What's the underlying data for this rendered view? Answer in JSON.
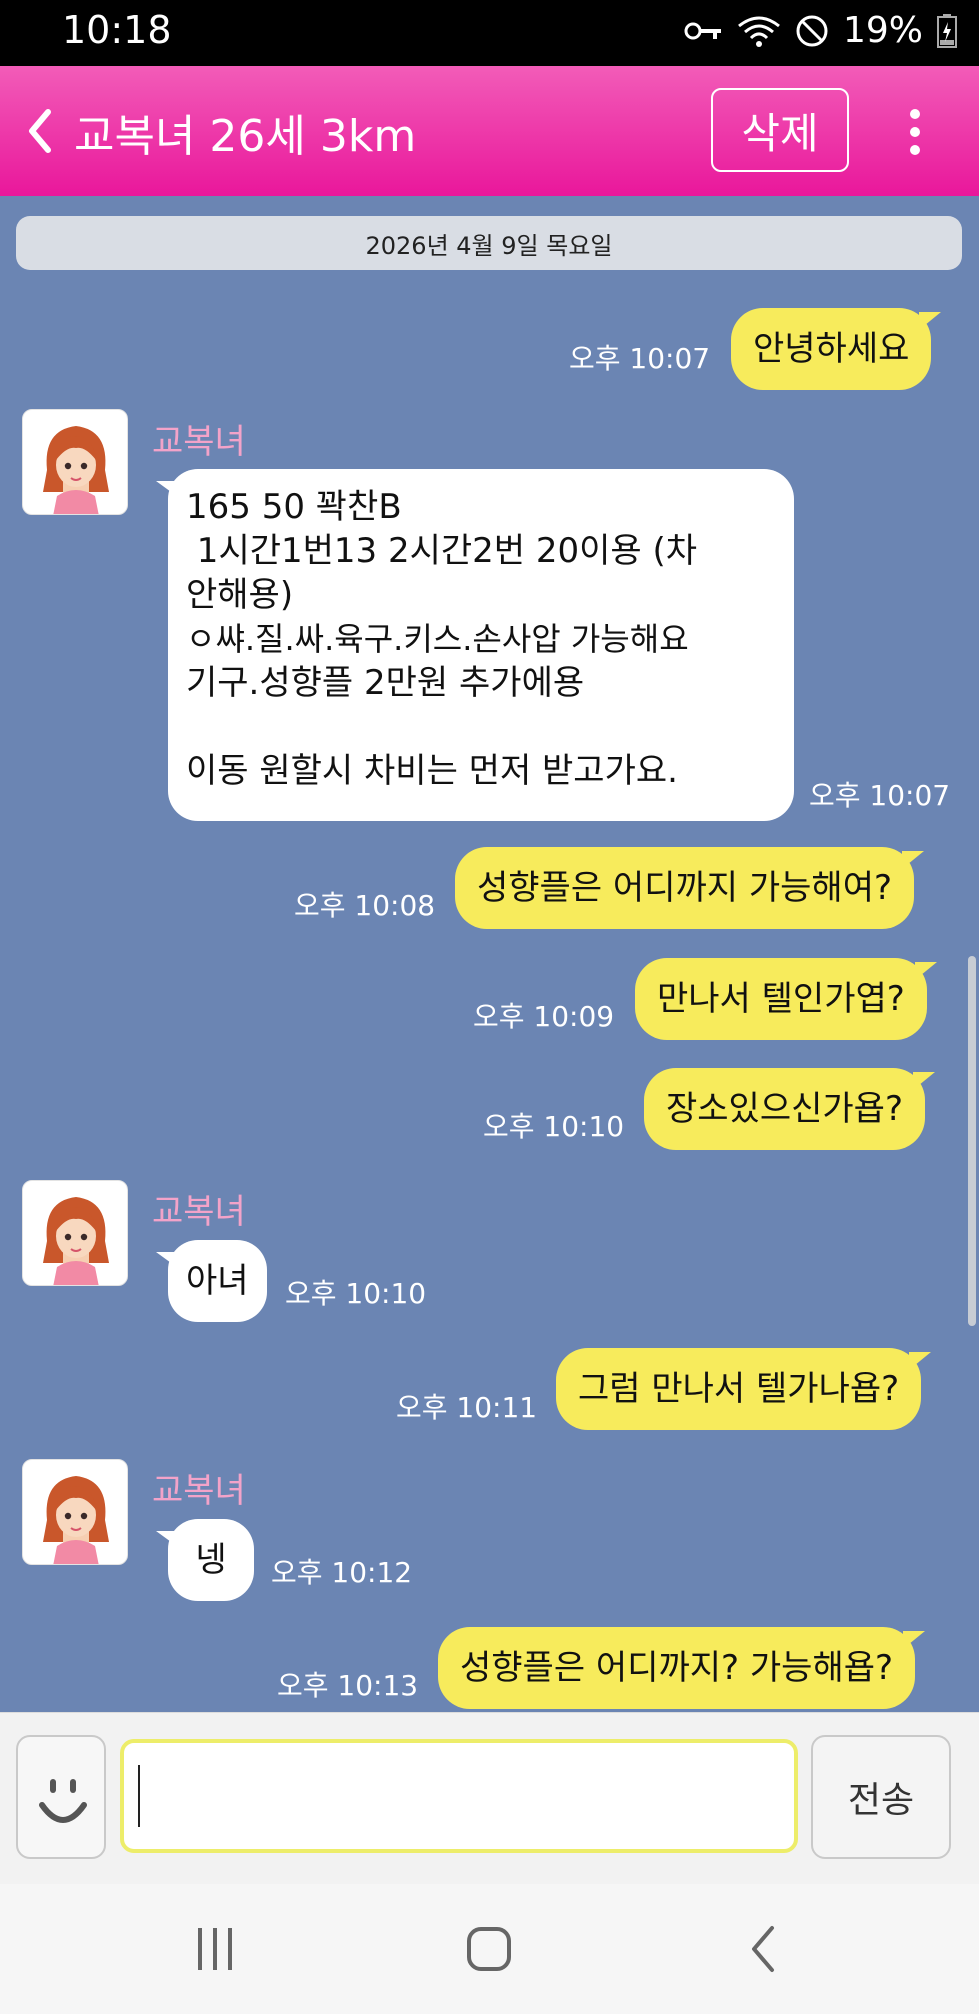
{
  "status_bar": {
    "time": "10:18",
    "battery_percent": "19%"
  },
  "header": {
    "title": "교복녀 26세 3km",
    "delete_label": "삭제"
  },
  "date_separator": "2026년 4월 9일 목요일",
  "messages": [
    {
      "from": "me",
      "text": "안녕하세요",
      "time": "오후 10:07"
    },
    {
      "from": "them",
      "sender": "교복녀",
      "lines": [
        "165 50 꽉찬B",
        " 1시간1번13 2시간2번 20이용 (차",
        "안해용)",
        "ㅇ쌰.질.싸.육구.키스.손사압 가능해요",
        "기구.성향플 2만원 추가에용",
        "",
        "이동 원할시 차비는 먼저 받고가요."
      ],
      "time": "오후 10:07"
    },
    {
      "from": "me",
      "text": "성향플은 어디까지 가능해여?",
      "time": "오후 10:08"
    },
    {
      "from": "me",
      "text": "만나서 텔인가엽?",
      "time": "오후 10:09"
    },
    {
      "from": "me",
      "text": "장소있으신가욥?",
      "time": "오후 10:10"
    },
    {
      "from": "them",
      "sender": "교복녀",
      "text": "아녀",
      "time": "오후 10:10"
    },
    {
      "from": "me",
      "text": "그럼 만나서 텔가나욥?",
      "time": "오후 10:11"
    },
    {
      "from": "them",
      "sender": "교복녀",
      "text": "넹",
      "time": "오후 10:12"
    },
    {
      "from": "me",
      "text": "성향플은 어디까지? 가능해욥?",
      "time": "오후 10:13"
    }
  ],
  "input": {
    "value": "",
    "placeholder": "",
    "send_label": "전송"
  },
  "colors": {
    "header_pink": "#ef3aa8",
    "chat_bg": "#6b85b3",
    "my_bubble": "#f7eb5c",
    "their_bubble": "#ffffff",
    "sender_name": "#f3a3c9"
  },
  "icons": [
    "back-chevron-icon",
    "more-vertical-icon",
    "key-icon",
    "wifi-icon",
    "do-not-disturb-icon",
    "battery-charging-icon",
    "smiley-icon",
    "recent-apps-icon",
    "home-icon",
    "back-nav-icon"
  ]
}
